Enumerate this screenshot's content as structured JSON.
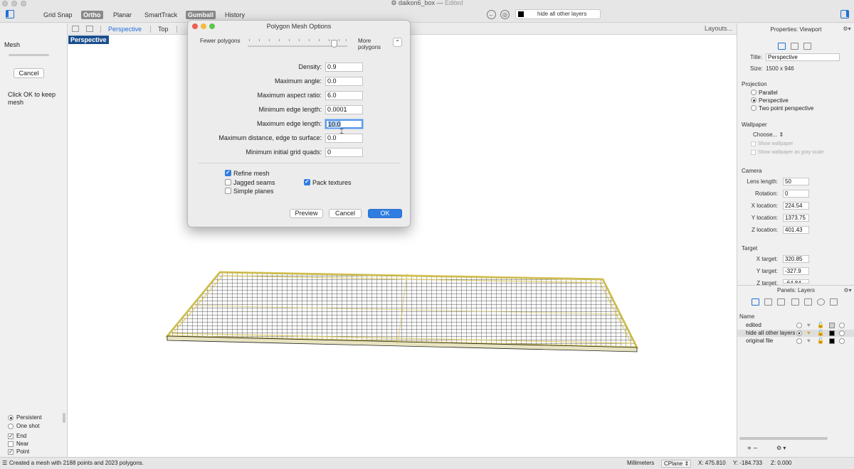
{
  "window": {
    "title": "daikon6_box",
    "status": "Edited"
  },
  "toolbar": {
    "items": [
      {
        "label": "Grid Snap",
        "active": false
      },
      {
        "label": "Ortho",
        "active": true
      },
      {
        "label": "Planar",
        "active": false
      },
      {
        "label": "SmartTrack",
        "active": false
      },
      {
        "label": "Gumball",
        "active": true
      },
      {
        "label": "History",
        "active": false
      }
    ],
    "layer_selector": "hide all other layers"
  },
  "left_panel": {
    "title": "Mesh",
    "cancel_label": "Cancel",
    "message": "Click OK to keep mesh",
    "osnap": [
      {
        "label": "Persistent",
        "type": "radio",
        "checked": true
      },
      {
        "label": "One shot",
        "type": "radio",
        "checked": false
      },
      {
        "label": "End",
        "type": "check",
        "checked": true
      },
      {
        "label": "Near",
        "type": "check",
        "checked": false
      },
      {
        "label": "Point",
        "type": "check",
        "checked": true
      }
    ]
  },
  "viewport": {
    "tabs": [
      "Perspective",
      "Top"
    ],
    "active_tab": "Perspective",
    "label": "Perspective",
    "layouts_label": "Layouts..."
  },
  "dialog": {
    "title": "Polygon Mesh Options",
    "fewer_label": "Fewer polygons",
    "more_label": "More polygons",
    "slider_level": 0.84,
    "fields": [
      {
        "label": "Density:",
        "value": "0.9"
      },
      {
        "label": "Maximum angle:",
        "value": "0.0"
      },
      {
        "label": "Maximum aspect ratio:",
        "value": "6.0"
      },
      {
        "label": "Minimum edge length:",
        "value": "0.0001"
      },
      {
        "label": "Maximum edge length:",
        "value": "10.0"
      },
      {
        "label": "Maximum distance, edge to surface:",
        "value": "0.0"
      },
      {
        "label": "Minimum initial grid quads:",
        "value": "0"
      }
    ],
    "checks": {
      "refine_mesh": {
        "label": "Refine mesh",
        "checked": true
      },
      "jagged_seams": {
        "label": "Jagged seams",
        "checked": false
      },
      "simple_planes": {
        "label": "Simple planes",
        "checked": false
      },
      "pack_textures": {
        "label": "Pack textures",
        "checked": true
      }
    },
    "buttons": {
      "preview": "Preview",
      "cancel": "Cancel",
      "ok": "OK"
    }
  },
  "properties": {
    "header": "Properties: Viewport",
    "title_label": "Title:",
    "title_value": "Perspective",
    "size_label": "Size:",
    "size_value": "1500 x 946",
    "projection_label": "Projection",
    "projection_options": [
      {
        "label": "Parallel",
        "selected": false
      },
      {
        "label": "Perspective",
        "selected": true
      },
      {
        "label": "Two point perspective",
        "selected": false
      }
    ],
    "wallpaper_label": "Wallpaper",
    "wallpaper_choose": "Choose...",
    "show_wallpaper": "Show wallpaper",
    "show_wallpaper_gray": "Show wallpaper as gray scale",
    "camera_label": "Camera",
    "camera_fields": [
      {
        "label": "Lens length:",
        "value": "50"
      },
      {
        "label": "Rotation:",
        "value": "0"
      },
      {
        "label": "X location:",
        "value": "224.54"
      },
      {
        "label": "Y location:",
        "value": "1373.75"
      },
      {
        "label": "Z location:",
        "value": "401.43"
      }
    ],
    "target_label": "Target",
    "target_fields": [
      {
        "label": "X target:",
        "value": "320.85"
      },
      {
        "label": "Y target:",
        "value": "-327.9"
      },
      {
        "label": "Z target:",
        "value": "-64.84"
      }
    ]
  },
  "layers": {
    "header": "Panels: Layers",
    "name_col": "Name",
    "rows": [
      {
        "name": "edited",
        "selected": false,
        "current": false,
        "color": "#cfcfcf"
      },
      {
        "name": "hide all other layers",
        "selected": true,
        "current": true,
        "color": "#000000"
      },
      {
        "name": "original file",
        "selected": false,
        "current": false,
        "color": "#000000"
      }
    ],
    "add_remove": "+ −"
  },
  "status": {
    "message": "Created a mesh with 2188 points and 2023 polygons.",
    "units": "Millimeters",
    "cplane": "CPlane",
    "x": "X: 475.810",
    "y": "Y: -184.733",
    "z": "Z: 0.000"
  }
}
